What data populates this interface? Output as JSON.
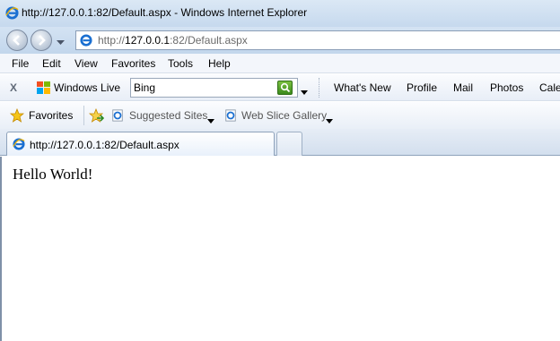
{
  "window": {
    "title": "http://127.0.0.1:82/Default.aspx - Windows Internet Explorer"
  },
  "address": {
    "url_prefix": "http://",
    "url_host": "127.0.0.1",
    "url_rest": ":82/Default.aspx"
  },
  "menu": {
    "items": [
      "File",
      "Edit",
      "View",
      "Favorites",
      "Tools",
      "Help"
    ]
  },
  "windows_live": {
    "close": "X",
    "brand": "Windows Live",
    "search_value": "Bing",
    "links": [
      "What's New",
      "Profile",
      "Mail",
      "Photos",
      "Cale"
    ]
  },
  "favorites_bar": {
    "label": "Favorites",
    "suggested_sites": "Suggested Sites",
    "web_slice_gallery": "Web Slice Gallery"
  },
  "tab": {
    "title": "http://127.0.0.1:82/Default.aspx"
  },
  "page": {
    "body_text": "Hello World!"
  },
  "icons": {
    "browser": "ie-icon",
    "search_go": "search-go-icon",
    "favorites": "favorites-star-icon",
    "add_favorites": "add-to-favorites-icon"
  },
  "colors": {
    "chrome": "#c6d9ee",
    "search_go": "#3b8a1c"
  }
}
